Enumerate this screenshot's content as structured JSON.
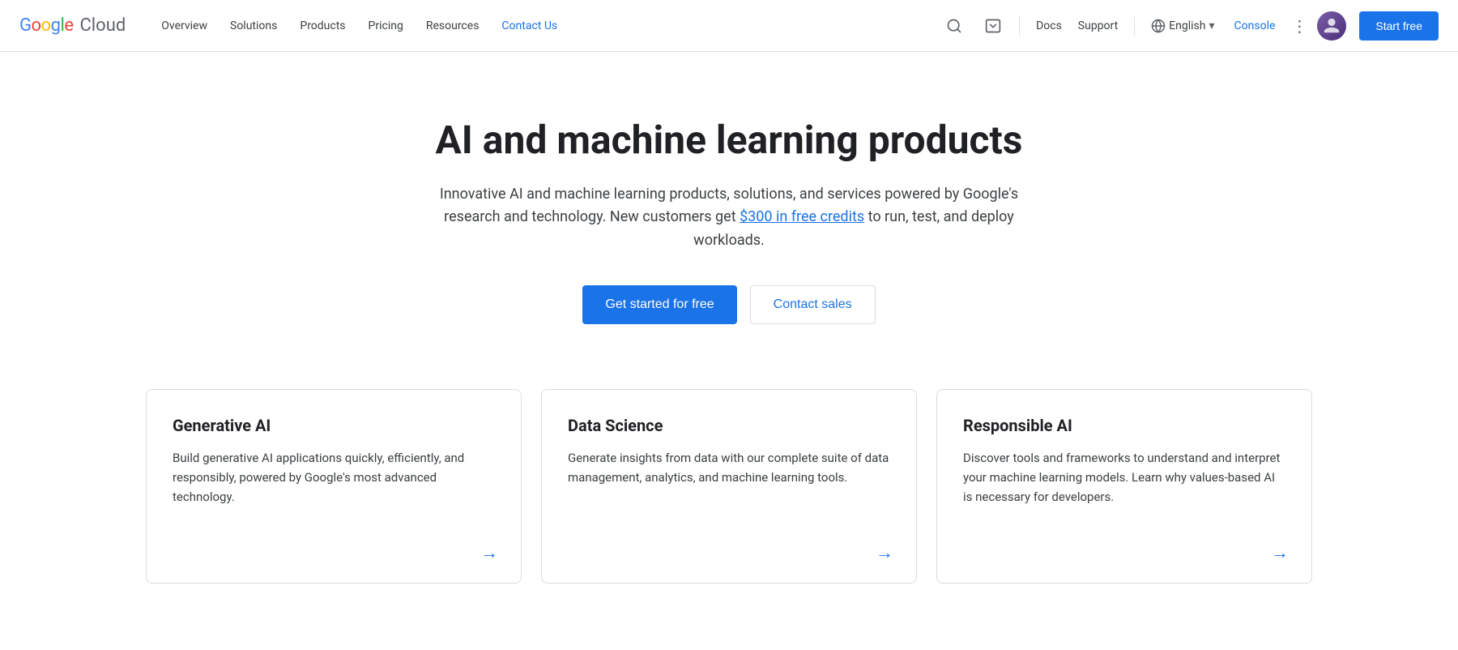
{
  "navbar": {
    "logo_google": "Google",
    "logo_cloud": "Cloud",
    "links": [
      {
        "label": "Overview",
        "active": false
      },
      {
        "label": "Solutions",
        "active": false
      },
      {
        "label": "Products",
        "active": false
      },
      {
        "label": "Pricing",
        "active": false
      },
      {
        "label": "Resources",
        "active": false
      },
      {
        "label": "Contact Us",
        "active": true
      }
    ],
    "docs_label": "Docs",
    "support_label": "Support",
    "language_label": "English",
    "console_label": "Console",
    "start_free_label": "Start free"
  },
  "hero": {
    "title": "AI and machine learning products",
    "description_part1": "Innovative AI and machine learning products, solutions, and services powered by Google's research and technology. New customers get ",
    "credits_link": "$300 in free credits",
    "description_part2": " to run, test, and deploy workloads.",
    "cta_primary": "Get started for free",
    "cta_secondary": "Contact sales"
  },
  "cards": [
    {
      "id": "generative-ai",
      "title": "Generative AI",
      "description": "Build generative AI applications quickly, efficiently, and responsibly, powered by Google's most advanced technology.",
      "arrow": "→"
    },
    {
      "id": "data-science",
      "title": "Data Science",
      "description": "Generate insights from data with our complete suite of data management, analytics, and machine learning tools.",
      "arrow": "→"
    },
    {
      "id": "responsible-ai",
      "title": "Responsible AI",
      "description": "Discover tools and frameworks to understand and interpret your machine learning models. Learn why values-based AI is necessary for developers.",
      "arrow": "→"
    }
  ],
  "icons": {
    "search": "🔍",
    "terminal": "⬛",
    "globe": "🌐",
    "chevron_down": "▾",
    "more_vert": "⋮"
  }
}
